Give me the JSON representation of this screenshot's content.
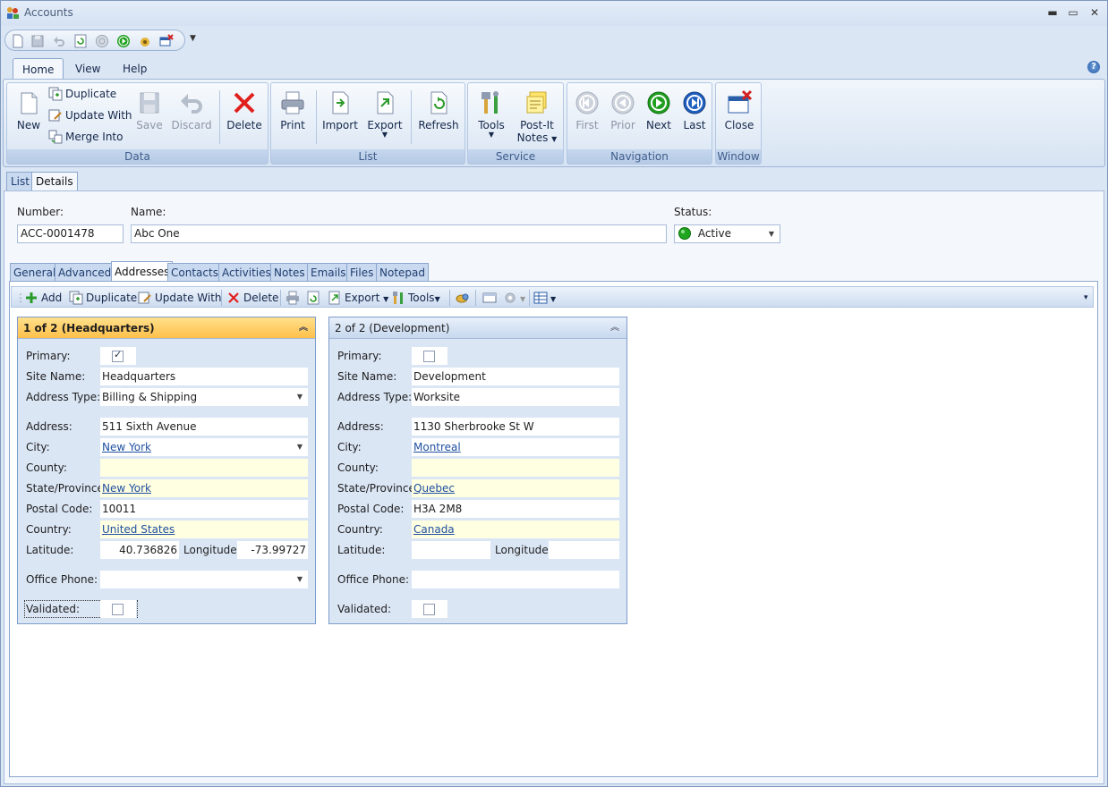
{
  "window": {
    "title": "Accounts",
    "minimize": "▬",
    "maximize": "▭",
    "close": "✕"
  },
  "ribbon_tabs": [
    "Home",
    "View",
    "Help"
  ],
  "help_glyph": "?",
  "ribbon": {
    "data_group": {
      "label": "Data",
      "new": "New",
      "duplicate": "Duplicate",
      "update_with": "Update With",
      "merge_into": "Merge Into",
      "save": "Save",
      "discard": "Discard",
      "delete": "Delete"
    },
    "list_group": {
      "label": "List",
      "print": "Print",
      "import": "Import",
      "export": "Export",
      "refresh": "Refresh"
    },
    "service_group": {
      "label": "Service",
      "tools": "Tools",
      "post_it_notes_1": "Post-It",
      "post_it_notes_2": "Notes"
    },
    "navigation_group": {
      "label": "Navigation",
      "first": "First",
      "prior": "Prior",
      "next": "Next",
      "last": "Last"
    },
    "window_group": {
      "label": "Window",
      "close": "Close"
    }
  },
  "doc_tabs": [
    "List",
    "Details"
  ],
  "header": {
    "number_label": "Number:",
    "number_value": "ACC-0001478",
    "name_label": "Name:",
    "name_value": "Abc One",
    "status_label": "Status:",
    "status_value": "Active"
  },
  "detail_tabs": [
    "General",
    "Advanced",
    "Addresses",
    "Contacts",
    "Activities",
    "Notes",
    "Emails",
    "Files",
    "Notepad"
  ],
  "address_toolbar": {
    "add": "Add",
    "duplicate": "Duplicate",
    "update_with": "Update With",
    "delete": "Delete",
    "export": "Export",
    "tools": "Tools"
  },
  "labels": {
    "primary": "Primary:",
    "site_name": "Site Name:",
    "address_type": "Address Type:",
    "address": "Address:",
    "city": "City:",
    "county": "County:",
    "state": "State/Province:",
    "postal": "Postal Code:",
    "country": "Country:",
    "latitude": "Latitude:",
    "longitude": "Longitude:",
    "office_phone": "Office Phone:",
    "validated": "Validated:"
  },
  "addresses": [
    {
      "header": "1 of 2 (Headquarters)",
      "primary": true,
      "site_name": "Headquarters",
      "address_type": "Billing & Shipping",
      "address": "511 Sixth Avenue",
      "city": "New York",
      "county": "",
      "state": "New York",
      "postal": "10011",
      "country": "United States",
      "latitude": "40.736826",
      "longitude": "-73.99727",
      "office_phone": "",
      "validated": false
    },
    {
      "header": "2 of 2 (Development)",
      "primary": false,
      "site_name": "Development",
      "address_type": "Worksite",
      "address": "1130 Sherbrooke St W",
      "city": "Montreal",
      "county": "",
      "state": "Quebec",
      "postal": "H3A 2M8",
      "country": "Canada",
      "latitude": "",
      "longitude": "",
      "office_phone": "",
      "validated": false
    }
  ],
  "colors": {
    "active_card": "#ffc04a",
    "link": "#1f4fa0",
    "lookup_field": "#ffffe1",
    "status_green": "#1fa51f"
  }
}
